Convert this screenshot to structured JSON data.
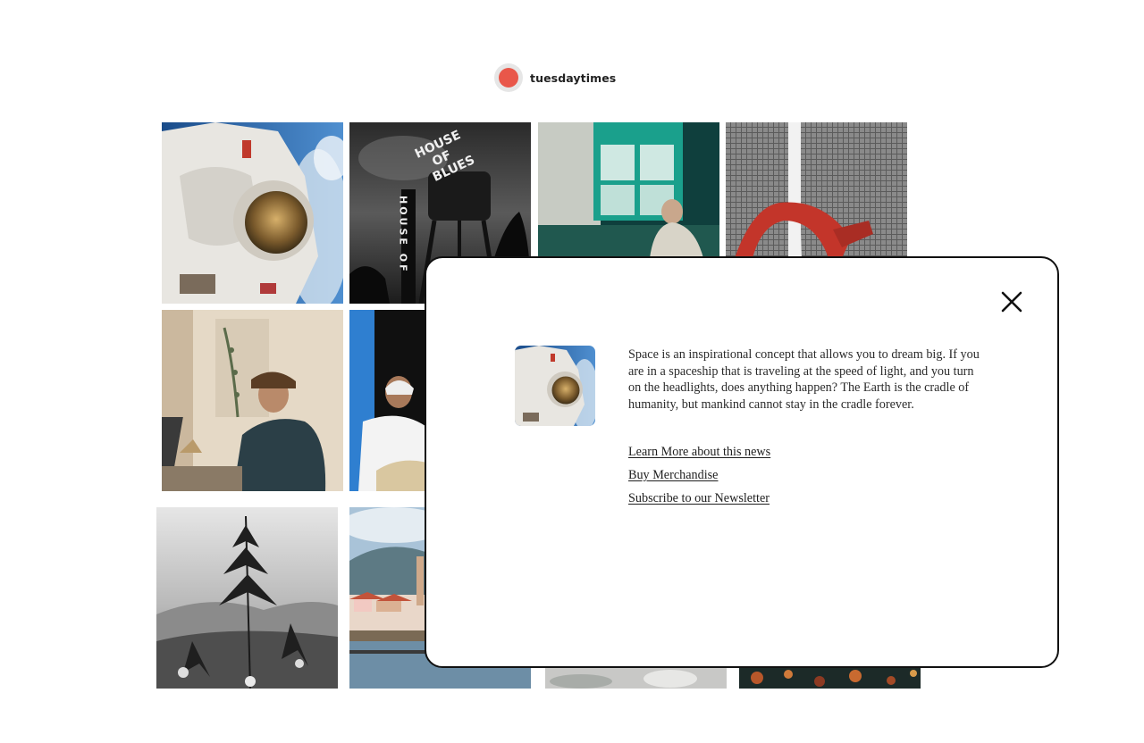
{
  "profile": {
    "username": "tuesdaytimes",
    "avatar_color": "#e9574a"
  },
  "grid": {
    "tiles": [
      {
        "subject": "astronaut in space"
      },
      {
        "subject": "water tower with sign",
        "sign_text": [
          "HOUSE",
          "OF",
          "BLUES"
        ],
        "vertical_text": "HOUSE OF"
      },
      {
        "subject": "old man by green window"
      },
      {
        "subject": "skyscrapers with red sculpture"
      },
      {
        "subject": "man working on laptop"
      },
      {
        "subject": "old man seated by blue wall"
      },
      {
        "subject": "black and white plant"
      },
      {
        "subject": "coastal town"
      },
      {
        "subject": "blurred landscape"
      },
      {
        "subject": "autumn foliage"
      }
    ]
  },
  "modal": {
    "description": "Space is an inspirational concept that allows you to dream big. If you are in a spaceship that is traveling at the speed of light, and you turn on the headlights, does anything happen? The Earth is the cradle of humanity, but mankind cannot stay in the cradle forever.",
    "links": [
      {
        "label": "Learn More about this news"
      },
      {
        "label": "Buy Merchandise"
      },
      {
        "label": "Subscribe to our Newsletter"
      }
    ],
    "close_icon": "close-icon"
  }
}
